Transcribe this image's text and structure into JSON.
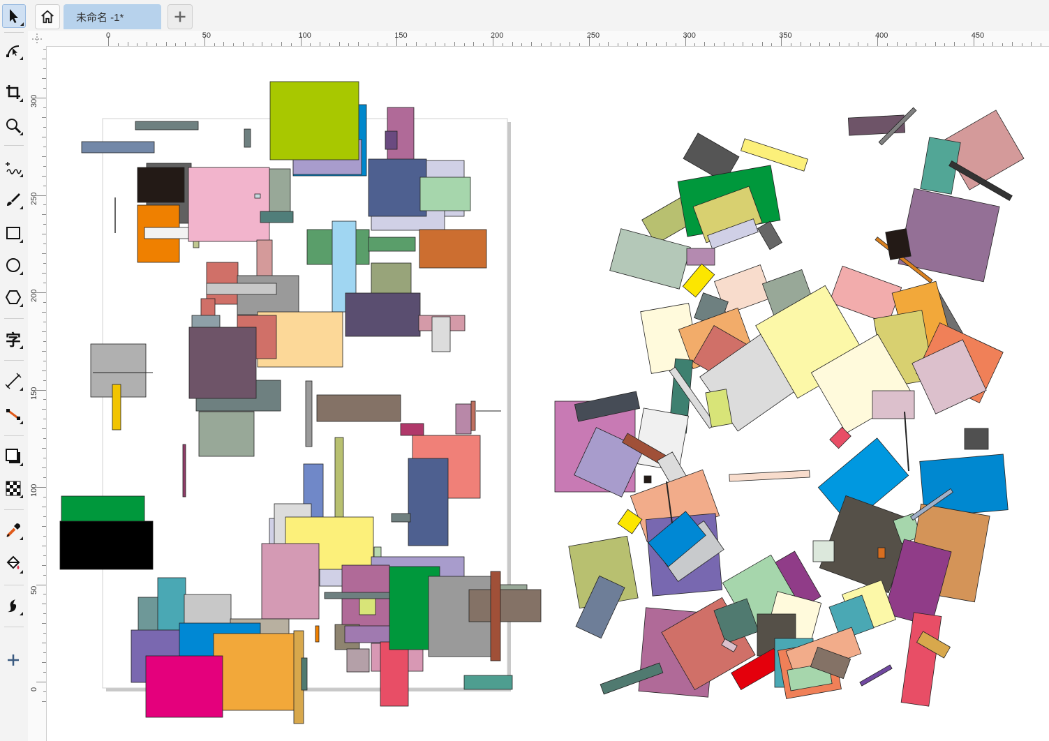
{
  "tabs": {
    "home_icon": "home-icon",
    "document_title": "未命名 -1*",
    "new_tab_icon": "plus-icon"
  },
  "toolbar": {
    "tools": [
      {
        "name": "pick-tool",
        "icon": "arrow-pointer-icon",
        "active": true
      },
      {
        "name": "shape-tool",
        "icon": "node-edit-icon"
      },
      {
        "name": "crop-tool",
        "icon": "crop-icon"
      },
      {
        "name": "zoom-tool",
        "icon": "magnifier-icon"
      },
      {
        "name": "freehand-tool",
        "icon": "freehand-icon"
      },
      {
        "name": "artistic-media-tool",
        "icon": "brush-icon"
      },
      {
        "name": "rectangle-tool",
        "icon": "rectangle-icon"
      },
      {
        "name": "ellipse-tool",
        "icon": "ellipse-icon"
      },
      {
        "name": "polygon-tool",
        "icon": "hexagon-icon"
      },
      {
        "name": "text-tool",
        "icon": "text-icon",
        "label": "字"
      },
      {
        "name": "line-tool",
        "icon": "dimension-line-icon"
      },
      {
        "name": "connector-tool",
        "icon": "connector-icon"
      },
      {
        "name": "drop-shadow-tool",
        "icon": "drop-shadow-icon"
      },
      {
        "name": "transparency-tool",
        "icon": "transparency-icon"
      },
      {
        "name": "eyedropper-tool",
        "icon": "eyedropper-icon"
      },
      {
        "name": "fill-tool",
        "icon": "paint-bucket-icon"
      },
      {
        "name": "smart-fill-tool",
        "icon": "smart-fill-icon"
      },
      {
        "name": "add-tool",
        "icon": "plus-icon"
      }
    ]
  },
  "rulers": {
    "horizontal_labels": [
      "0",
      "50",
      "100",
      "150",
      "200",
      "250",
      "300",
      "350",
      "400",
      "450"
    ],
    "vertical_labels": [
      "300",
      "250",
      "200",
      "150",
      "100",
      "50",
      "0"
    ]
  },
  "colors": {
    "accent": "#b7d2ec",
    "canvas": "#ffffff",
    "ruler": "#fafafa",
    "toolbar": "#f3f3f3"
  }
}
